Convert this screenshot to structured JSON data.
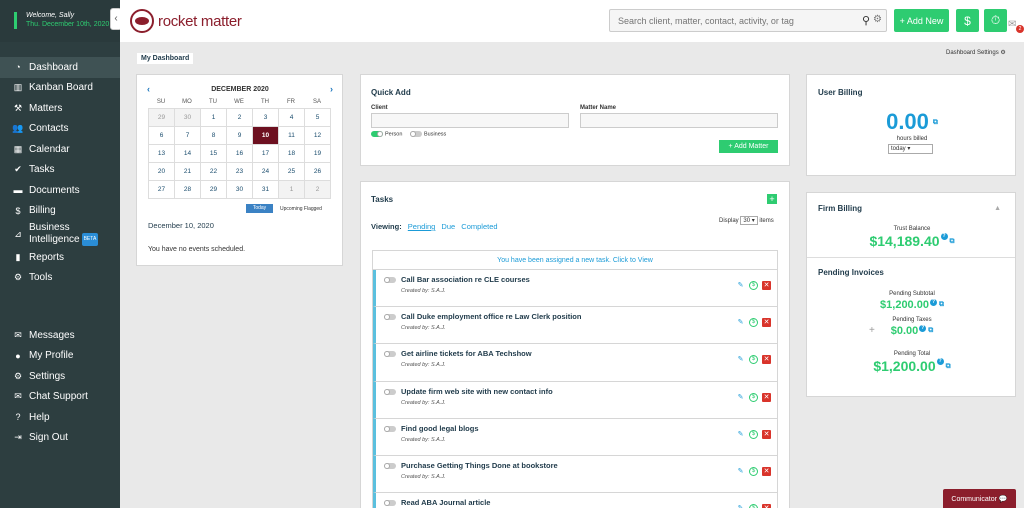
{
  "sidebar": {
    "welcome": "Welcome, Sally",
    "date": "Thu. December 10th, 2020",
    "nav_top": [
      {
        "label": "Dashboard",
        "icon": "dashboard-icon",
        "glyph": "◔",
        "active": true
      },
      {
        "label": "Kanban Board",
        "icon": "kanban-icon",
        "glyph": "▥"
      },
      {
        "label": "Matters",
        "icon": "gavel-icon",
        "glyph": "⚒"
      },
      {
        "label": "Contacts",
        "icon": "contacts-icon",
        "glyph": "👥"
      },
      {
        "label": "Calendar",
        "icon": "calendar-icon",
        "glyph": "▦"
      },
      {
        "label": "Tasks",
        "icon": "check-icon",
        "glyph": "✔"
      },
      {
        "label": "Documents",
        "icon": "folder-icon",
        "glyph": "▬"
      },
      {
        "label": "Billing",
        "icon": "dollar-icon",
        "glyph": "$"
      },
      {
        "label": "Business",
        "label2": "Intelligence",
        "badge": "BETA",
        "icon": "chart-icon",
        "glyph": "⊿"
      },
      {
        "label": "Reports",
        "icon": "bar-chart-icon",
        "glyph": "▮"
      },
      {
        "label": "Tools",
        "icon": "wrench-icon",
        "glyph": "⚙"
      }
    ],
    "nav_bottom": [
      {
        "label": "Messages",
        "icon": "chat-icon",
        "glyph": "✉"
      },
      {
        "label": "My Profile",
        "icon": "user-icon",
        "glyph": "●"
      },
      {
        "label": "Settings",
        "icon": "gear-icon",
        "glyph": "⚙"
      },
      {
        "label": "Chat Support",
        "icon": "support-icon",
        "glyph": "✉"
      },
      {
        "label": "Help",
        "icon": "help-icon",
        "glyph": "?"
      },
      {
        "label": "Sign Out",
        "icon": "signout-icon",
        "glyph": "⇥"
      }
    ]
  },
  "header": {
    "logo": "rocket matter",
    "search_placeholder": "Search client, matter, contact, activity, or tag",
    "add_new": "+ Add New",
    "mail_badge": "2"
  },
  "main": {
    "tab": "My Dashboard",
    "settings_link": "Dashboard Settings ⚙"
  },
  "calendar": {
    "month": "DECEMBER 2020",
    "prev": "‹",
    "next": "›",
    "dow": [
      "SU",
      "MO",
      "TU",
      "WE",
      "TH",
      "FR",
      "SA"
    ],
    "weeks": [
      [
        {
          "d": "29",
          "o": true
        },
        {
          "d": "30",
          "o": true
        },
        {
          "d": "1"
        },
        {
          "d": "2"
        },
        {
          "d": "3"
        },
        {
          "d": "4"
        },
        {
          "d": "5"
        }
      ],
      [
        {
          "d": "6"
        },
        {
          "d": "7"
        },
        {
          "d": "8"
        },
        {
          "d": "9"
        },
        {
          "d": "10",
          "t": true
        },
        {
          "d": "11"
        },
        {
          "d": "12"
        }
      ],
      [
        {
          "d": "13"
        },
        {
          "d": "14"
        },
        {
          "d": "15"
        },
        {
          "d": "16"
        },
        {
          "d": "17"
        },
        {
          "d": "18"
        },
        {
          "d": "19"
        }
      ],
      [
        {
          "d": "20"
        },
        {
          "d": "21"
        },
        {
          "d": "22"
        },
        {
          "d": "23"
        },
        {
          "d": "24"
        },
        {
          "d": "25"
        },
        {
          "d": "26"
        }
      ],
      [
        {
          "d": "27"
        },
        {
          "d": "28"
        },
        {
          "d": "29"
        },
        {
          "d": "30"
        },
        {
          "d": "31"
        },
        {
          "d": "1",
          "o": true
        },
        {
          "d": "2",
          "o": true
        }
      ]
    ],
    "today_btn": "Today",
    "upcoming": "Upcoming Flagged",
    "selected_date": "December 10, 2020",
    "no_events": "You have no events scheduled."
  },
  "quick_add": {
    "title": "Quick Add",
    "client_label": "Client",
    "matter_label": "Matter Name",
    "person": "Person",
    "business": "Business",
    "add_matter": "+ Add Matter"
  },
  "tasks": {
    "title": "Tasks",
    "viewing": "Viewing:",
    "filters": [
      "Pending",
      "Due",
      "Completed"
    ],
    "display": "Display",
    "display_count": "30 ▾",
    "items_label": "items",
    "notice": "You have been assigned a new task. Click to View",
    "items": [
      {
        "title": "Call Bar association re CLE courses",
        "created": "Created by: S.A.J."
      },
      {
        "title": "Call Duke employment office re Law Clerk position",
        "created": "Created by: S.A.J."
      },
      {
        "title": "Get airline tickets for ABA Techshow",
        "created": "Created by: S.A.J."
      },
      {
        "title": "Update firm web site with new contact info",
        "created": "Created by: S.A.J."
      },
      {
        "title": "Find good legal blogs",
        "created": "Created by: S.A.J."
      },
      {
        "title": "Purchase Getting Things Done at bookstore",
        "created": "Created by: S.A.J."
      },
      {
        "title": "Read ABA Journal article",
        "created": ""
      }
    ]
  },
  "user_billing": {
    "title": "User Billing",
    "value": "0.00",
    "label": "hours billed",
    "period": "today ▾"
  },
  "firm_billing": {
    "title": "Firm Billing",
    "trust_label": "Trust Balance",
    "trust_value": "$14,189.40",
    "pending_title": "Pending Invoices",
    "subtotal_label": "Pending Subtotal",
    "subtotal_value": "$1,200.00",
    "taxes_label": "Pending Taxes",
    "taxes_value": "$0.00",
    "total_label": "Pending Total",
    "total_value": "$1,200.00"
  },
  "communicator": "Communicator 💬"
}
